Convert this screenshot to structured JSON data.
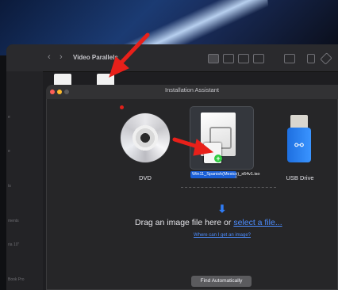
{
  "finder": {
    "title": "Video Parallels",
    "nav_back": "‹",
    "nav_forward": "›",
    "sidebar_items": [
      "e",
      "e",
      "ts",
      "ments",
      "ria 10\"",
      "Book Pro"
    ]
  },
  "assistant": {
    "title": "Installation Assistant",
    "options": {
      "dvd_label": "DVD",
      "usb_label": "USB Drive",
      "dragged_filename": "Win11_Spanish(Mexico)_x64v1.iso",
      "filename_tail": "e"
    },
    "drop_zone": {
      "drag_prefix": "Drag an image file here or ",
      "select_file_link": "select a file...",
      "where_link": "Where can I get an image?"
    },
    "find_automatically_button": "Find Automatically"
  },
  "icons": {
    "usb_symbol": "⚯",
    "down_arrow": "⬇",
    "plus": "+"
  },
  "colors": {
    "accent": "#2f7cf6",
    "annotation_arrow": "#e8201a"
  }
}
